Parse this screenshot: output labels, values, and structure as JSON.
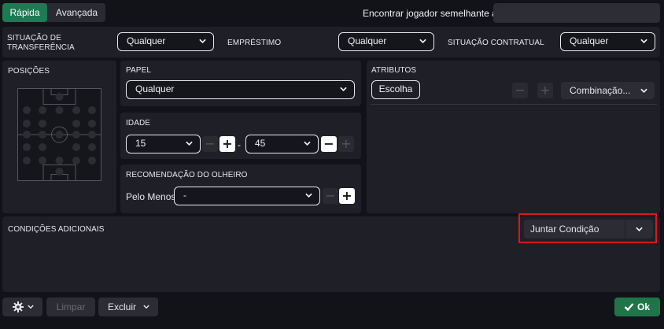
{
  "tabs": {
    "quick": "Rápida",
    "advanced": "Avançada"
  },
  "similar": {
    "label": "Encontrar jogador semelhante a",
    "placeholder": ""
  },
  "top_filters": {
    "transfer_status": {
      "label_line1": "SITUAÇÃO DE",
      "label_line2": "TRANSFERÊNCIA",
      "value": "Qualquer"
    },
    "loan": {
      "label": "EMPRÉSTIMO",
      "value": "Qualquer"
    },
    "contract": {
      "label": "SITUAÇÃO CONTRATUAL",
      "value": "Qualquer"
    }
  },
  "positions": {
    "label": "POSIÇÕES"
  },
  "role": {
    "label": "PAPEL",
    "value": "Qualquer"
  },
  "age": {
    "label": "IDADE",
    "min": "15",
    "max": "45",
    "separator": "-"
  },
  "scout": {
    "label": "RECOMENDAÇÃO DO OLHEIRO",
    "prefix": "Pelo Menos",
    "value": "-"
  },
  "attributes": {
    "label": "ATRIBUTOS",
    "choose_button": "Escolha",
    "combination": "Combinação..."
  },
  "conditions": {
    "label": "CONDIÇÕES ADICIONAIS",
    "join_condition": "Juntar Condição"
  },
  "footer": {
    "clear": "Limpar",
    "delete": "Excluir",
    "ok": "Ok"
  },
  "symbols": {
    "minus": "−",
    "plus": "+"
  },
  "colors": {
    "accent_green": "#1e7a52",
    "ok_green": "#1f7548",
    "highlight_red": "#e0141c"
  },
  "icons": {
    "settings": "gear-icon",
    "dropdown": "chevron-down-icon",
    "confirm": "check-icon"
  }
}
